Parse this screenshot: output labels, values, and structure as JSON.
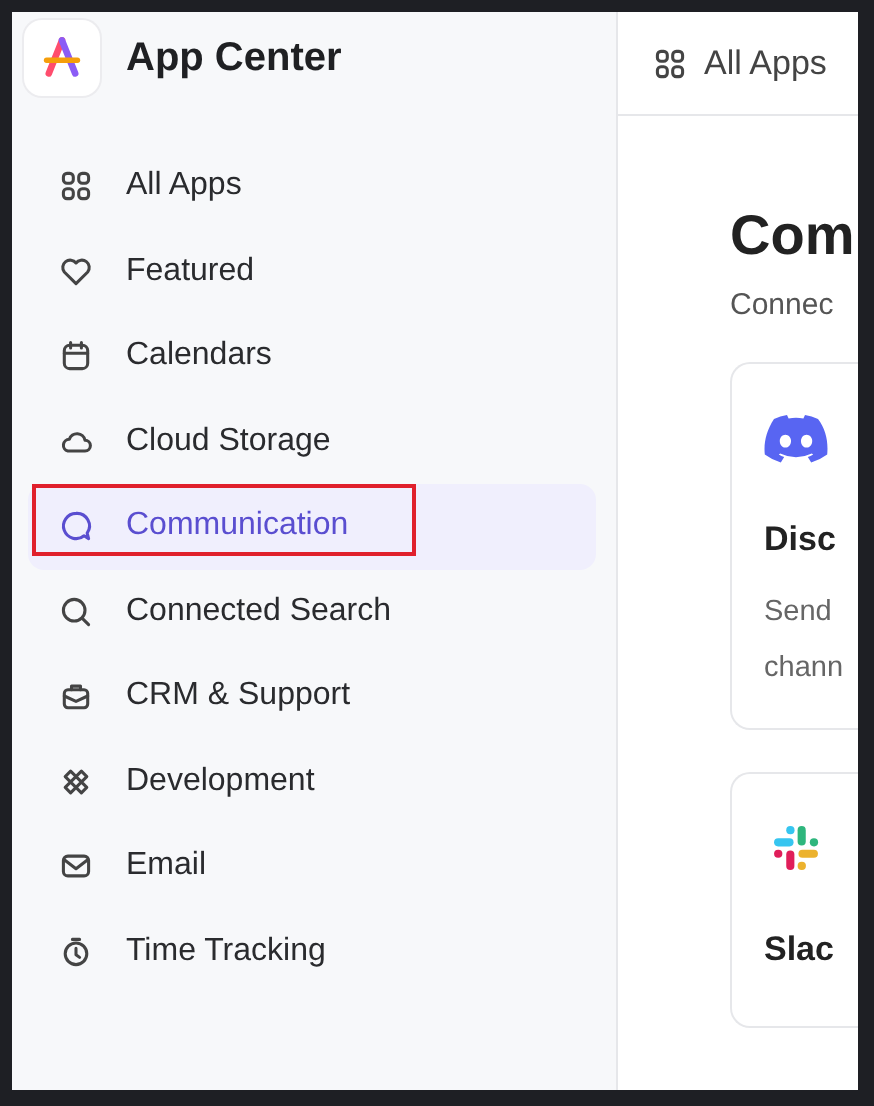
{
  "sidebar": {
    "title": "App Center",
    "items": [
      {
        "label": "All Apps",
        "kind": "grid",
        "selected": false,
        "annotated": false
      },
      {
        "label": "Featured",
        "kind": "heart",
        "selected": false,
        "annotated": false
      },
      {
        "label": "Calendars",
        "kind": "calendar",
        "selected": false,
        "annotated": false
      },
      {
        "label": "Cloud Storage",
        "kind": "cloud",
        "selected": false,
        "annotated": false
      },
      {
        "label": "Communication",
        "kind": "chat",
        "selected": true,
        "annotated": true
      },
      {
        "label": "Connected Search",
        "kind": "search",
        "selected": false,
        "annotated": false
      },
      {
        "label": "CRM & Support",
        "kind": "briefcase",
        "selected": false,
        "annotated": false
      },
      {
        "label": "Development",
        "kind": "dev",
        "selected": false,
        "annotated": false
      },
      {
        "label": "Email",
        "kind": "mail",
        "selected": false,
        "annotated": false
      },
      {
        "label": "Time Tracking",
        "kind": "timer",
        "selected": false,
        "annotated": false
      }
    ]
  },
  "breadcrumb": {
    "label": "All Apps"
  },
  "main": {
    "title": "Com",
    "subtitle": "Connec",
    "cards": [
      {
        "kind": "discord",
        "name": "Disc",
        "description": [
          "Send",
          "chann"
        ]
      },
      {
        "kind": "slack",
        "name": "Slac"
      }
    ]
  }
}
